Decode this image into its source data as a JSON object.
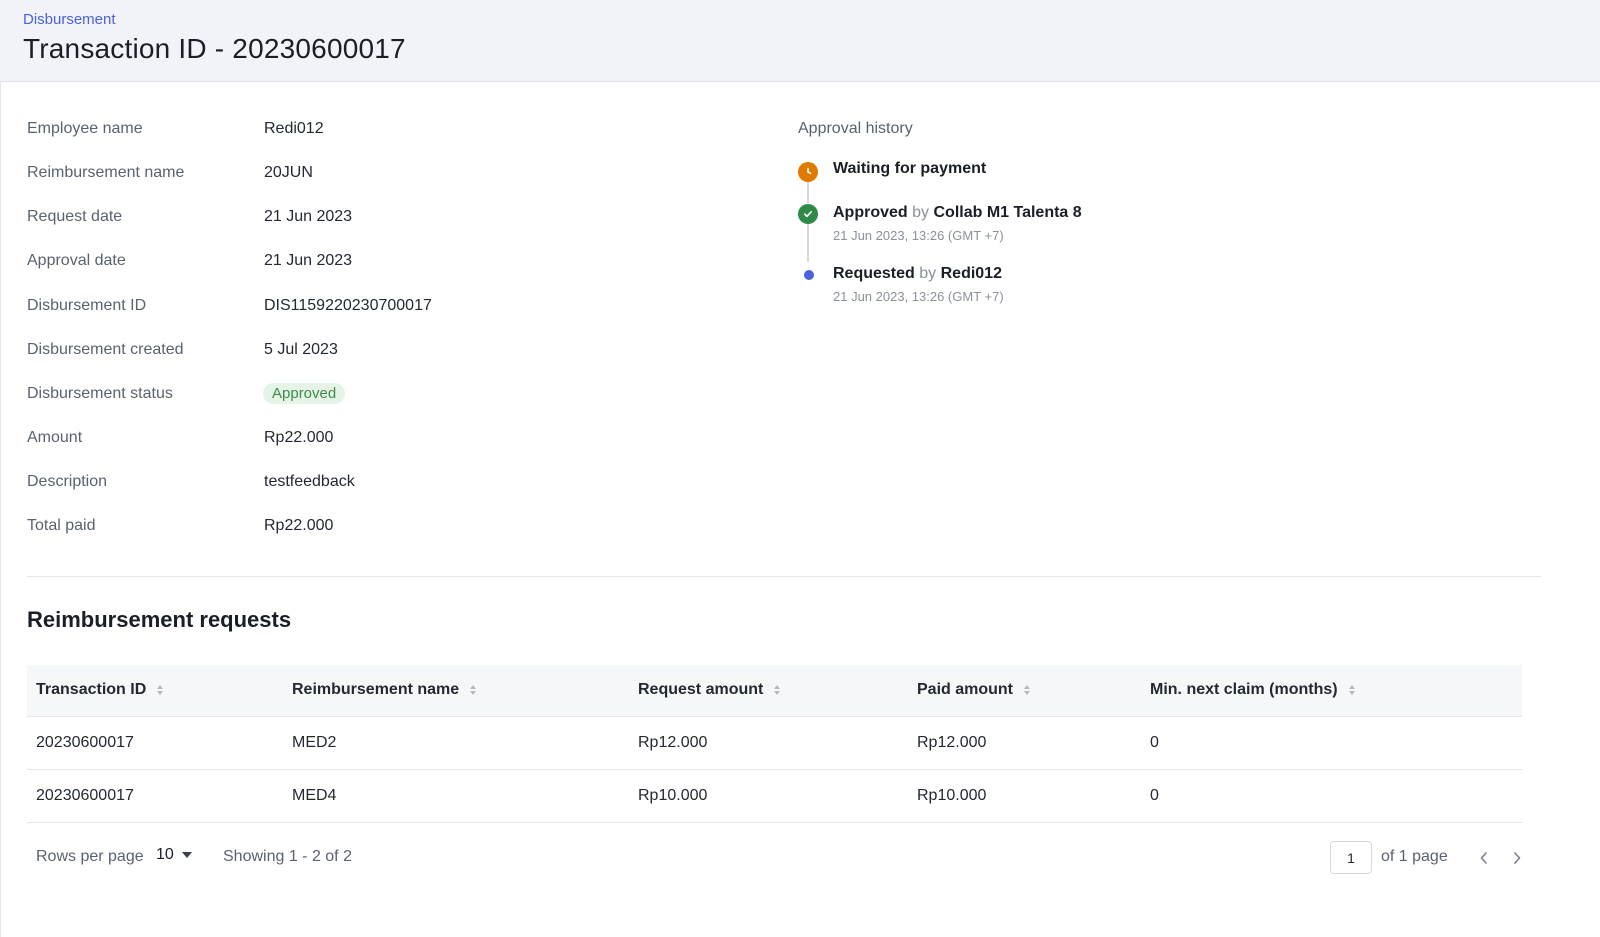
{
  "header": {
    "breadcrumb": "Disbursement",
    "title": "Transaction ID - 20230600017"
  },
  "details": [
    {
      "label": "Employee name",
      "value": "Redi012"
    },
    {
      "label": "Reimbursement name",
      "value": "20JUN"
    },
    {
      "label": "Request date",
      "value": "21 Jun 2023"
    },
    {
      "label": "Approval date",
      "value": "21 Jun 2023"
    },
    {
      "label": "Disbursement ID",
      "value": "DIS1159220230700017"
    },
    {
      "label": "Disbursement created",
      "value": "5 Jul 2023"
    },
    {
      "label": "Disbursement status",
      "value": "Approved"
    },
    {
      "label": "Amount",
      "value": "Rp22.000"
    },
    {
      "label": "Description",
      "value": "testfeedback"
    },
    {
      "label": "Total paid",
      "value": "Rp22.000"
    }
  ],
  "approval_history": {
    "title": "Approval history",
    "items": [
      {
        "status": "Waiting for payment",
        "by_word": "",
        "actor": "",
        "time": "",
        "icon": "clock-icon",
        "color": "#e07b00"
      },
      {
        "status": "Approved",
        "by_word": "by",
        "actor": "Collab M1 Talenta 8",
        "time": "21 Jun 2023, 13:26 (GMT +7)",
        "icon": "check-circle-icon",
        "color": "#2e8b47"
      },
      {
        "status": "Requested",
        "by_word": "by",
        "actor": "Redi012",
        "time": "21 Jun 2023, 13:26 (GMT +7)",
        "icon": "dot-icon",
        "color": "#4b61dd"
      }
    ]
  },
  "requests": {
    "title": "Reimbursement requests",
    "columns": [
      "Transaction ID",
      "Reimbursement name",
      "Request amount",
      "Paid amount",
      "Min. next claim (months)"
    ],
    "rows": [
      [
        "20230600017",
        "MED2",
        "Rp12.000",
        "Rp12.000",
        "0"
      ],
      [
        "20230600017",
        "MED4",
        "Rp10.000",
        "Rp10.000",
        "0"
      ]
    ]
  },
  "pagination": {
    "rows_per_page_label": "Rows per page",
    "rows_per_page_value": "10",
    "showing": "Showing 1 - 2 of 2",
    "page_value": "1",
    "of_page": "of 1 page"
  },
  "colors": {
    "accent": "#4b61dd",
    "approved_badge_bg": "#e6f4e8",
    "approved_badge_text": "#3c8c4a"
  }
}
